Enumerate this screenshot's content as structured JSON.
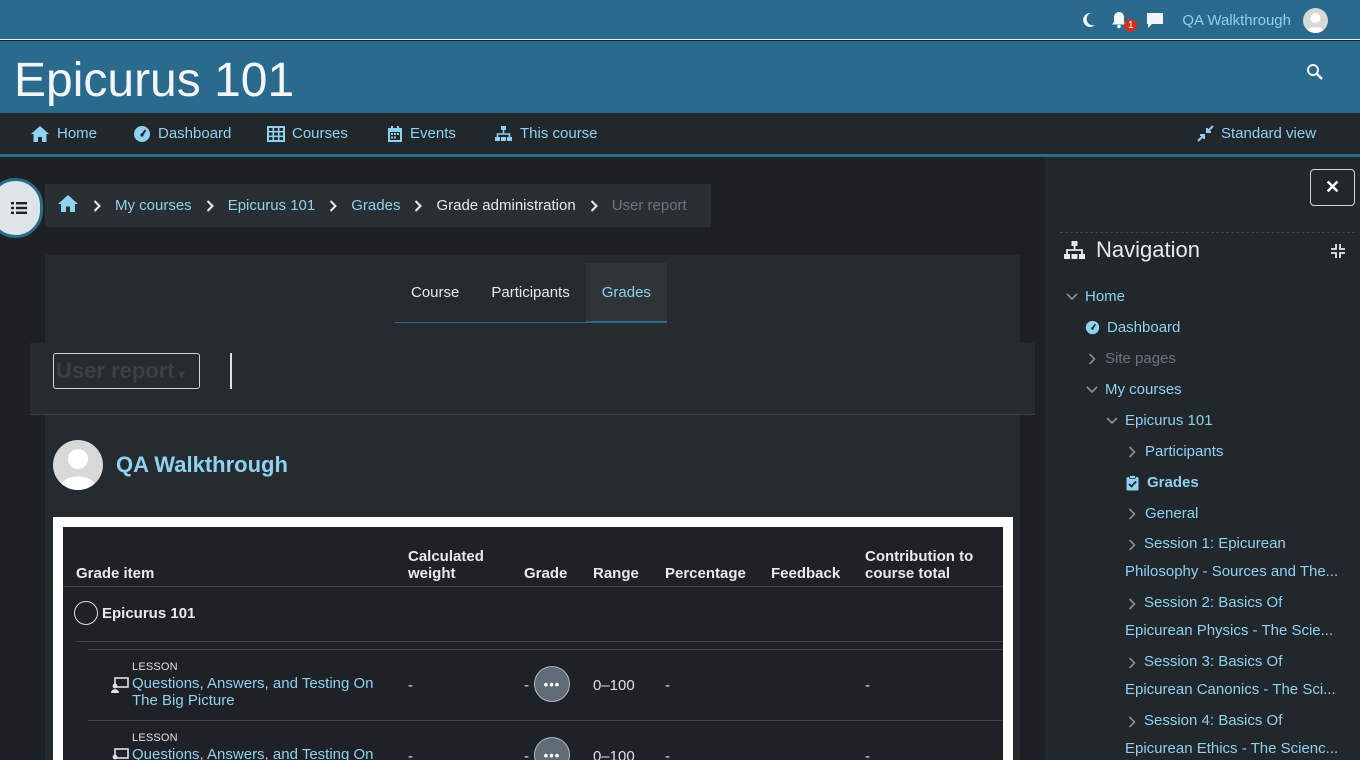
{
  "topbar": {
    "user_name": "QA Walkthrough",
    "notification_count": "1"
  },
  "header": {
    "course_title": "Epicurus 101"
  },
  "primary_nav": {
    "home": "Home",
    "dashboard": "Dashboard",
    "courses": "Courses",
    "events": "Events",
    "this_course": "This course",
    "standard_view": "Standard view"
  },
  "breadcrumb": {
    "my_courses": "My courses",
    "course": "Epicurus 101",
    "grades": "Grades",
    "grade_admin": "Grade administration",
    "user_report": "User report"
  },
  "tabs": [
    {
      "label": "Course"
    },
    {
      "label": "Participants"
    },
    {
      "label": "Grades"
    }
  ],
  "report_selector": {
    "value": "User report"
  },
  "user": {
    "name": "QA Walkthrough"
  },
  "grade_table": {
    "headers": {
      "grade_item": "Grade item",
      "calculated_weight": "Calculated weight",
      "grade": "Grade",
      "range": "Range",
      "percentage": "Percentage",
      "feedback": "Feedback",
      "contribution": "Contribution to course total"
    },
    "category": "Epicurus 101",
    "rows": [
      {
        "type": "LESSON",
        "name": "Questions, Answers, and Testing On The Big Picture",
        "weight": "-",
        "grade": "-",
        "range": "0–100",
        "percentage": "-",
        "contribution": "-"
      },
      {
        "type": "LESSON",
        "name": "Questions, Answers, and Testing On",
        "weight": "-",
        "grade": "-",
        "range": "0–100",
        "percentage": "-",
        "contribution": "-"
      }
    ]
  },
  "navigation": {
    "title": "Navigation",
    "home": "Home",
    "dashboard": "Dashboard",
    "site_pages": "Site pages",
    "my_courses": "My courses",
    "course": "Epicurus 101",
    "participants": "Participants",
    "grades": "Grades",
    "general": "General",
    "session1": "Session 1: Epicurean Philosophy - Sources and The...",
    "session2": "Session 2: Basics Of Epicurean Physics - The Scie...",
    "session3": "Session 3: Basics Of Epicurean Canonics - The Sci...",
    "session4": "Session 4: Basics Of Epicurean Ethics - The Scienc..."
  },
  "colors": {
    "brand": "#2a6a8c",
    "link": "#8fd1f0",
    "background": "#1d2125"
  }
}
